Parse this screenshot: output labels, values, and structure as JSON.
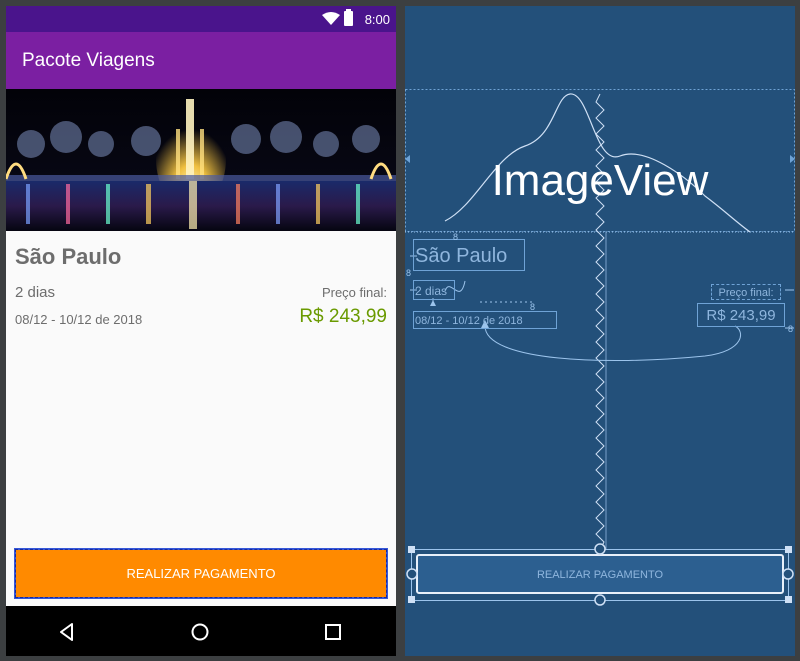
{
  "status_bar": {
    "time": "8:00",
    "wifi_icon": "wifi-icon",
    "battery_icon": "battery-icon"
  },
  "app_bar": {
    "title": "Pacote Viagens"
  },
  "hero": {
    "description_icon": "city-fountain-night-image"
  },
  "trip": {
    "place": "São Paulo",
    "duration": "2 dias",
    "dates": "08/12 - 10/12 de 2018",
    "price_label": "Preço final:",
    "price_value": "R$ 243,99"
  },
  "pay_button": {
    "label": "REALIZAR PAGAMENTO"
  },
  "nav_bar": {
    "back_icon": "back-icon",
    "home_icon": "home-icon",
    "recents_icon": "recents-icon"
  },
  "blueprint": {
    "image_label": "ImageView",
    "place": "São Paulo",
    "duration": "2 dias",
    "dates": "08/12 - 10/12 de 2018",
    "price_label": "Preço final:",
    "price_value": "R$ 243,99",
    "button_label": "REALIZAR PAGAMENTO",
    "margin_label": "8"
  },
  "colors": {
    "status_bar": "#4a148c",
    "app_bar": "#7b1fa2",
    "button": "#ff8a00",
    "price": "#6a9a00",
    "blueprint_bg": "#23507a"
  }
}
